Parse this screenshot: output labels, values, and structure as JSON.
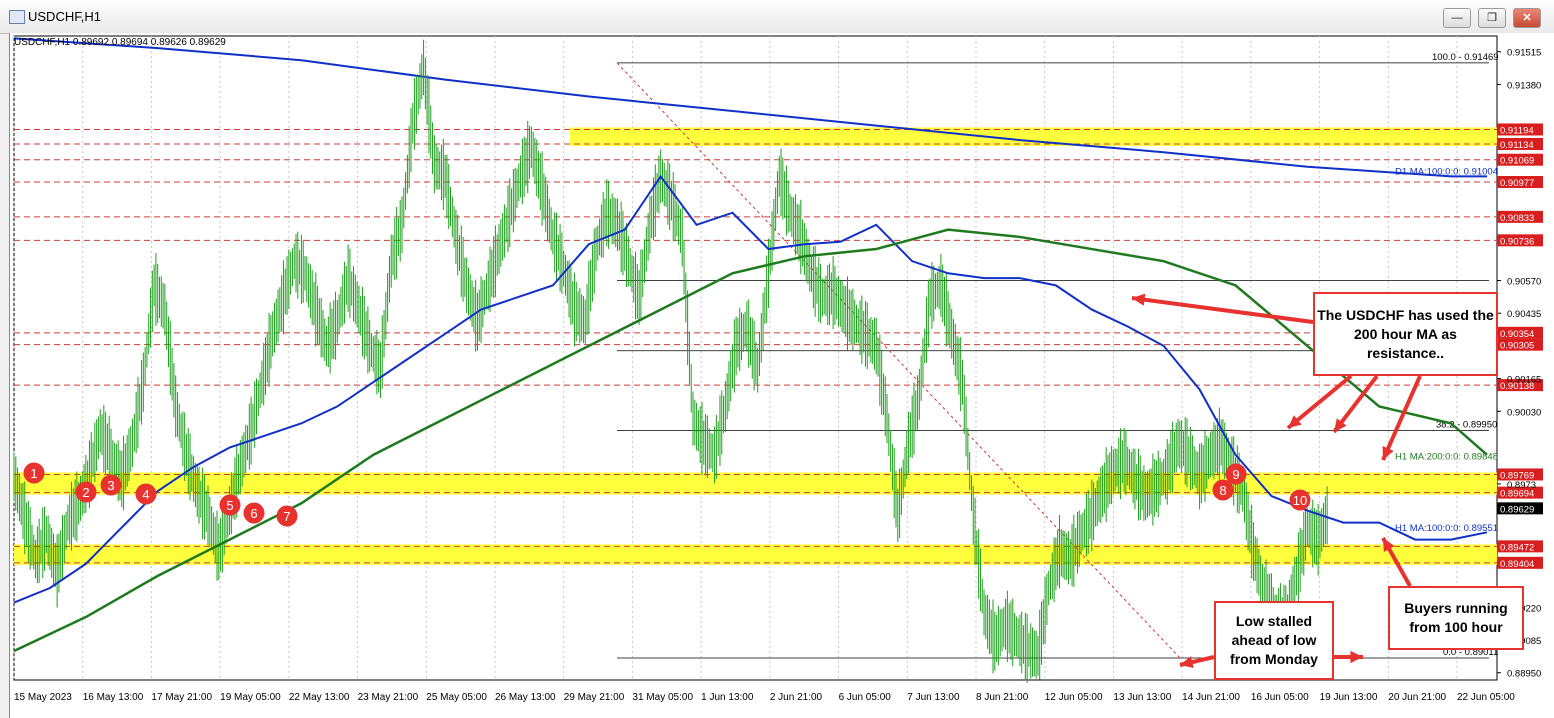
{
  "window": {
    "title": "USDCHF,H1",
    "buttons": {
      "minimize": "—",
      "restore": "❐",
      "close": "✕"
    }
  },
  "chart_header": "USDCHF,H1  0.89692 0.89694 0.89626 0.89629",
  "colors": {
    "candle": "#1e9e1e",
    "ma100": "#1030c8",
    "ma200": "#1f7a1f",
    "d1ma": "#1030c8",
    "zone": "#ffff33",
    "level_line": "#d23a3a",
    "marker": "#e8322e",
    "arrow": "#e8322e"
  },
  "chart_data": {
    "type": "candlestick",
    "symbol": "USDCHF",
    "timeframe": "H1",
    "ylim": [
      0.8892,
      0.9158
    ],
    "y_ticks": [
      0.91515,
      0.9138,
      0.9057,
      0.90435,
      0.90165,
      0.9003,
      0.8973,
      0.8922,
      0.89085,
      0.8895
    ],
    "y_tick_labels": [
      "0.91515",
      "0.91380",
      "0.90570",
      "0.90435",
      "0.90165",
      "0.90030",
      "0.8973",
      "0.89220",
      "0.89085",
      "0.88950"
    ],
    "x_tick_labels": [
      "15 May 2023",
      "16 May 13:00",
      "17 May 21:00",
      "19 May 05:00",
      "22 May 13:00",
      "23 May 21:00",
      "25 May 05:00",
      "26 May 13:00",
      "29 May 21:00",
      "31 May 05:00",
      "1 Jun 13:00",
      "2 Jun 21:00",
      "6 Jun 05:00",
      "7 Jun 13:00",
      "8 Jun 21:00",
      "12 Jun 05:00",
      "13 Jun 13:00",
      "14 Jun 21:00",
      "16 Jun 05:00",
      "19 Jun 13:00",
      "20 Jun 21:00",
      "22 Jun 05:00"
    ],
    "price_path": [
      [
        0,
        0.8976
      ],
      [
        3,
        0.8959
      ],
      [
        6,
        0.8942
      ],
      [
        9,
        0.8952
      ],
      [
        12,
        0.8937
      ],
      [
        15,
        0.8957
      ],
      [
        18,
        0.8965
      ],
      [
        21,
        0.8977
      ],
      [
        24,
        0.8995
      ],
      [
        27,
        0.8985
      ],
      [
        30,
        0.8975
      ],
      [
        33,
        0.899
      ],
      [
        36,
        0.9015
      ],
      [
        39,
        0.9055
      ],
      [
        42,
        0.9045
      ],
      [
        45,
        0.9005
      ],
      [
        48,
        0.8985
      ],
      [
        51,
        0.897
      ],
      [
        54,
        0.896
      ],
      [
        57,
        0.8945
      ],
      [
        60,
        0.8962
      ],
      [
        63,
        0.898
      ],
      [
        66,
        0.8995
      ],
      [
        69,
        0.9015
      ],
      [
        72,
        0.9035
      ],
      [
        75,
        0.905
      ],
      [
        78,
        0.9065
      ],
      [
        81,
        0.906
      ],
      [
        84,
        0.9045
      ],
      [
        87,
        0.903
      ],
      [
        90,
        0.904
      ],
      [
        93,
        0.9058
      ],
      [
        96,
        0.9045
      ],
      [
        99,
        0.903
      ],
      [
        102,
        0.902
      ],
      [
        105,
        0.9065
      ],
      [
        108,
        0.908
      ],
      [
        111,
        0.9122
      ],
      [
        114,
        0.9145
      ],
      [
        117,
        0.9105
      ],
      [
        120,
        0.91
      ],
      [
        123,
        0.9075
      ],
      [
        126,
        0.9055
      ],
      [
        129,
        0.904
      ],
      [
        132,
        0.9055
      ],
      [
        135,
        0.907
      ],
      [
        138,
        0.9085
      ],
      [
        141,
        0.91
      ],
      [
        144,
        0.9112
      ],
      [
        147,
        0.9095
      ],
      [
        150,
        0.9075
      ],
      [
        153,
        0.9062
      ],
      [
        156,
        0.9045
      ],
      [
        159,
        0.904
      ],
      [
        162,
        0.907
      ],
      [
        165,
        0.9085
      ],
      [
        168,
        0.908
      ],
      [
        171,
        0.9065
      ],
      [
        174,
        0.905
      ],
      [
        177,
        0.908
      ],
      [
        180,
        0.91
      ],
      [
        183,
        0.909
      ],
      [
        186,
        0.9075
      ],
      [
        189,
        0.9
      ],
      [
        192,
        0.899
      ],
      [
        195,
        0.8985
      ],
      [
        198,
        0.9005
      ],
      [
        201,
        0.903
      ],
      [
        204,
        0.9038
      ],
      [
        207,
        0.902
      ],
      [
        210,
        0.906
      ],
      [
        213,
        0.91
      ],
      [
        216,
        0.9085
      ],
      [
        219,
        0.9075
      ],
      [
        222,
        0.906
      ],
      [
        225,
        0.905
      ],
      [
        228,
        0.9052
      ],
      [
        231,
        0.9045
      ],
      [
        234,
        0.904
      ],
      [
        237,
        0.9035
      ],
      [
        240,
        0.903
      ],
      [
        243,
        0.9
      ],
      [
        246,
        0.896
      ],
      [
        249,
        0.899
      ],
      [
        252,
        0.901
      ],
      [
        255,
        0.905
      ],
      [
        258,
        0.9055
      ],
      [
        261,
        0.9035
      ],
      [
        264,
        0.9015
      ],
      [
        267,
        0.896
      ],
      [
        270,
        0.892
      ],
      [
        273,
        0.8908
      ],
      [
        276,
        0.8915
      ],
      [
        279,
        0.891
      ],
      [
        282,
        0.8905
      ],
      [
        285,
        0.8902
      ],
      [
        288,
        0.893
      ],
      [
        291,
        0.8945
      ],
      [
        294,
        0.8942
      ],
      [
        297,
        0.8952
      ],
      [
        300,
        0.896
      ],
      [
        303,
        0.897
      ],
      [
        306,
        0.8978
      ],
      [
        309,
        0.8983
      ],
      [
        312,
        0.8975
      ],
      [
        315,
        0.8968
      ],
      [
        318,
        0.8972
      ],
      [
        321,
        0.8978
      ],
      [
        324,
        0.899
      ],
      [
        327,
        0.8985
      ],
      [
        330,
        0.8976
      ],
      [
        333,
        0.8985
      ],
      [
        336,
        0.899
      ],
      [
        339,
        0.898
      ],
      [
        342,
        0.897
      ],
      [
        345,
        0.8945
      ],
      [
        348,
        0.8928
      ],
      [
        351,
        0.892
      ],
      [
        354,
        0.8917
      ],
      [
        357,
        0.8935
      ],
      [
        360,
        0.8955
      ],
      [
        363,
        0.895
      ],
      [
        366,
        0.8962
      ]
    ],
    "ma100_path": [
      [
        0,
        0.8924
      ],
      [
        10,
        0.893
      ],
      [
        20,
        0.894
      ],
      [
        30,
        0.8955
      ],
      [
        40,
        0.897
      ],
      [
        50,
        0.898
      ],
      [
        60,
        0.8988
      ],
      [
        70,
        0.8993
      ],
      [
        80,
        0.8998
      ],
      [
        90,
        0.9005
      ],
      [
        100,
        0.9015
      ],
      [
        110,
        0.9025
      ],
      [
        120,
        0.9035
      ],
      [
        130,
        0.9045
      ],
      [
        140,
        0.905
      ],
      [
        150,
        0.9055
      ],
      [
        160,
        0.9072
      ],
      [
        170,
        0.9078
      ],
      [
        180,
        0.91
      ],
      [
        190,
        0.908
      ],
      [
        200,
        0.9085
      ],
      [
        210,
        0.907
      ],
      [
        220,
        0.9072
      ],
      [
        230,
        0.9073
      ],
      [
        240,
        0.908
      ],
      [
        250,
        0.9065
      ],
      [
        260,
        0.906
      ],
      [
        270,
        0.9058
      ],
      [
        280,
        0.9058
      ],
      [
        290,
        0.9055
      ],
      [
        300,
        0.9045
      ],
      [
        310,
        0.9038
      ],
      [
        320,
        0.903
      ],
      [
        330,
        0.9012
      ],
      [
        340,
        0.8985
      ],
      [
        350,
        0.8968
      ],
      [
        360,
        0.8962
      ],
      [
        370,
        0.8957
      ],
      [
        380,
        0.8957
      ],
      [
        390,
        0.895
      ],
      [
        400,
        0.895
      ],
      [
        410,
        0.8953
      ]
    ],
    "ma200_path": [
      [
        0,
        0.8904
      ],
      [
        20,
        0.8918
      ],
      [
        40,
        0.8935
      ],
      [
        60,
        0.895
      ],
      [
        80,
        0.8965
      ],
      [
        100,
        0.8985
      ],
      [
        120,
        0.9
      ],
      [
        140,
        0.9015
      ],
      [
        160,
        0.903
      ],
      [
        180,
        0.9045
      ],
      [
        200,
        0.906
      ],
      [
        220,
        0.9067
      ],
      [
        240,
        0.907
      ],
      [
        260,
        0.9078
      ],
      [
        280,
        0.9075
      ],
      [
        300,
        0.907
      ],
      [
        320,
        0.9065
      ],
      [
        340,
        0.9055
      ],
      [
        360,
        0.903
      ],
      [
        380,
        0.9005
      ],
      [
        400,
        0.8998
      ],
      [
        410,
        0.8985
      ]
    ],
    "d1_ma_path": [
      [
        0,
        0.9157
      ],
      [
        40,
        0.9153
      ],
      [
        80,
        0.9148
      ],
      [
        120,
        0.914
      ],
      [
        160,
        0.9133
      ],
      [
        200,
        0.9127
      ],
      [
        240,
        0.9121
      ],
      [
        280,
        0.9115
      ],
      [
        320,
        0.911
      ],
      [
        360,
        0.9104
      ],
      [
        400,
        0.91
      ],
      [
        410,
        0.91
      ]
    ],
    "horizontal_levels": [
      {
        "price": 0.91194,
        "label": "0.91194",
        "style": "dashed"
      },
      {
        "price": 0.91134,
        "label": "0.91134",
        "style": "dashed"
      },
      {
        "price": 0.91069,
        "label": "0.91069",
        "style": "dashed"
      },
      {
        "price": 0.90977,
        "label": "0.90977",
        "style": "dashed"
      },
      {
        "price": 0.90833,
        "label": "0.90833",
        "style": "dashed"
      },
      {
        "price": 0.90736,
        "label": "0.90736",
        "style": "dashed"
      },
      {
        "price": 0.90354,
        "label": "0.90354",
        "style": "dashed"
      },
      {
        "price": 0.90305,
        "label": "0.90305",
        "style": "dashed"
      },
      {
        "price": 0.90138,
        "label": "0.90138",
        "style": "dashed"
      },
      {
        "price": 0.89769,
        "label": "0.89769",
        "style": "dashed"
      },
      {
        "price": 0.89694,
        "label": "0.89694",
        "style": "dashed"
      },
      {
        "price": 0.89472,
        "label": "0.89472",
        "style": "dashed"
      },
      {
        "price": 0.89404,
        "label": "0.89404",
        "style": "dashed"
      }
    ],
    "current_price_label": "0.89629",
    "zones": [
      {
        "from": 0.91134,
        "to": 0.91194
      },
      {
        "from": 0.89694,
        "to": 0.89769
      },
      {
        "from": 0.89404,
        "to": 0.89472
      }
    ],
    "fibonacci": {
      "high_label": "100.0 - 0.91469",
      "low_label": "0.0 - 0.89011",
      "level_382_label": "38.2 - 0.89950",
      "levels": [
        0.91469,
        0.9057,
        0.9028,
        0.8995,
        0.89011
      ]
    },
    "ma_labels": {
      "d1": "D1 MA:100:0:0: 0.91004",
      "h1_200": "H1 MA:200:0:0: 0.89848",
      "h1_100": "H1 MA:100:0:0: 0.89551"
    },
    "markers": [
      "1",
      "2",
      "3",
      "4",
      "5",
      "6",
      "7",
      "8",
      "9",
      "10"
    ],
    "annotations": {
      "resistance": "The USDCHF has used the 200 hour MA as resistance..",
      "low": "Low stalled ahead of low from Monday",
      "buyers": "Buyers running from 100 hour"
    }
  }
}
